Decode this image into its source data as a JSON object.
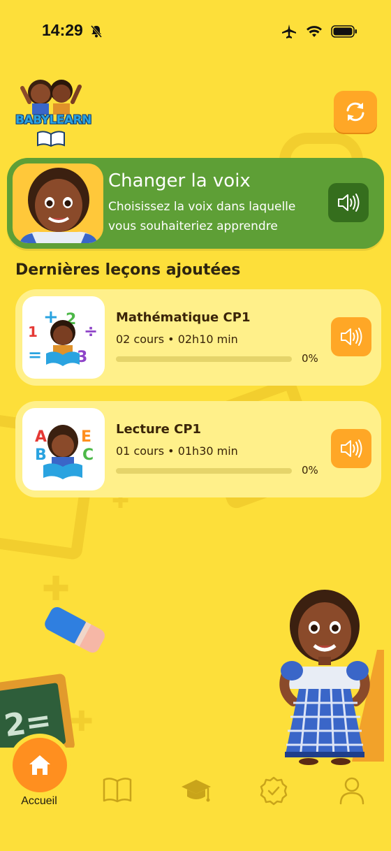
{
  "status_bar": {
    "time": "14:29",
    "icons": [
      "bell-slash-icon",
      "airplane-icon",
      "wifi-icon",
      "battery-icon"
    ]
  },
  "header": {
    "logo_text": "BABYLEARN",
    "refresh_icon": "refresh-icon"
  },
  "voice_card": {
    "title": "Changer la voix",
    "subtitle": "Choisissez la voix dans laquelle vous souhaiteriez apprendre",
    "speaker_icon": "speaker-icon"
  },
  "section": {
    "title": "Dernières leçons ajoutées"
  },
  "lessons": [
    {
      "title": "Mathématique CP1",
      "meta": "02 cours • 02h10 min",
      "progress": 0,
      "progress_label": "0%"
    },
    {
      "title": "Lecture CP1",
      "meta": "01 cours • 01h30 min",
      "progress": 0,
      "progress_label": "0%"
    }
  ],
  "nav": {
    "items": [
      {
        "label": "Accueil",
        "icon": "home-icon",
        "active": true
      },
      {
        "label": "",
        "icon": "book-icon"
      },
      {
        "label": "",
        "icon": "graduation-cap-icon"
      },
      {
        "label": "",
        "icon": "badge-check-icon"
      },
      {
        "label": "",
        "icon": "user-icon"
      }
    ]
  },
  "colors": {
    "background": "#FDDF3A",
    "voice_card": "#5E9F36",
    "accent_orange": "#FFA726",
    "lesson_card": "#FFF08A"
  }
}
